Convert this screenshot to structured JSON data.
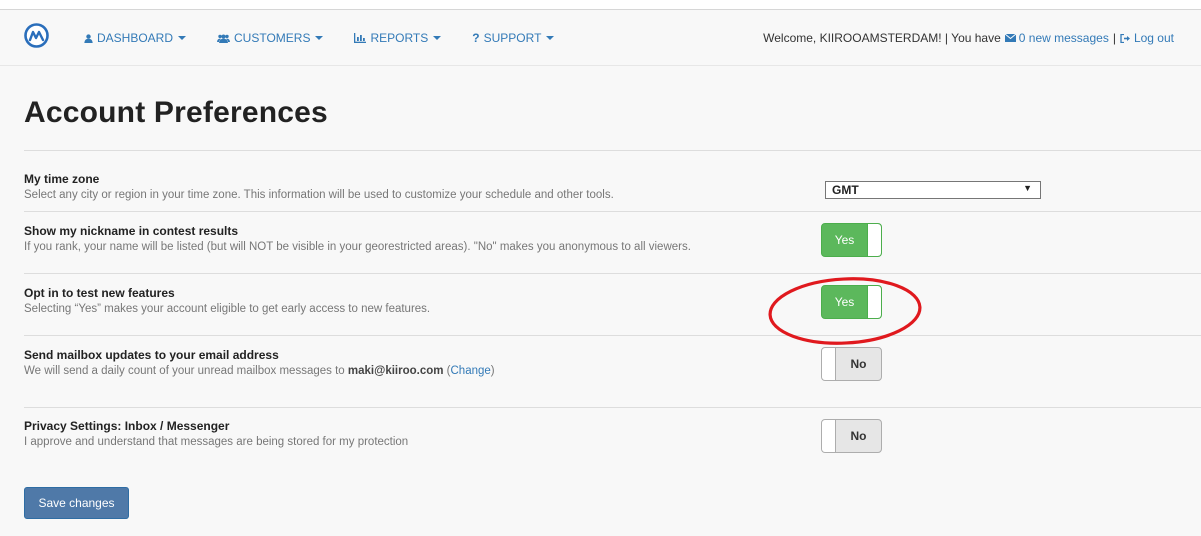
{
  "navbar": {
    "logo_icon": "m-circle-logo-icon",
    "menu": [
      {
        "label": "DASHBOARD",
        "icon": "user-icon"
      },
      {
        "label": "CUSTOMERS",
        "icon": "users-icon"
      },
      {
        "label": "REPORTS",
        "icon": "bar-chart-icon"
      },
      {
        "label": "SUPPORT",
        "icon": "question-icon"
      }
    ],
    "welcome": "Welcome, KIIROOAMSTERDAM! | You have",
    "messages_link": "0 new messages",
    "logout": "Log out"
  },
  "page_title": "Account Preferences",
  "preferences": [
    {
      "label": "My time zone",
      "description": "Select any city or region in your time zone. This information will be used to customize your schedule and other tools.",
      "control": "select",
      "value": "GMT"
    },
    {
      "label": "Show my nickname in contest results",
      "description": "If you rank, your name will be listed (but will NOT be visible in your georestricted areas). \"No\" makes you anonymous to all viewers.",
      "control": "toggle",
      "value": "Yes"
    },
    {
      "label": "Opt in to test new features",
      "description": "Selecting “Yes” makes your account eligible to get early access to new features.",
      "control": "toggle",
      "value": "Yes"
    },
    {
      "label": "Send mailbox updates to your email address",
      "description_prefix": "We will send a daily count of your unread mailbox messages to",
      "email": "maki@kiiroo.com",
      "change_link": "Change",
      "control": "toggle",
      "value": "No"
    },
    {
      "label": "Privacy Settings: Inbox / Messenger",
      "description": "I approve and understand that messages are being stored for my protection",
      "control": "toggle",
      "value": "No"
    }
  ],
  "save_label": "Save changes",
  "colors": {
    "link": "#337ab7",
    "toggle_on": "#5cb85c",
    "save_button": "#4f79a8",
    "highlight": "#e0191e"
  }
}
